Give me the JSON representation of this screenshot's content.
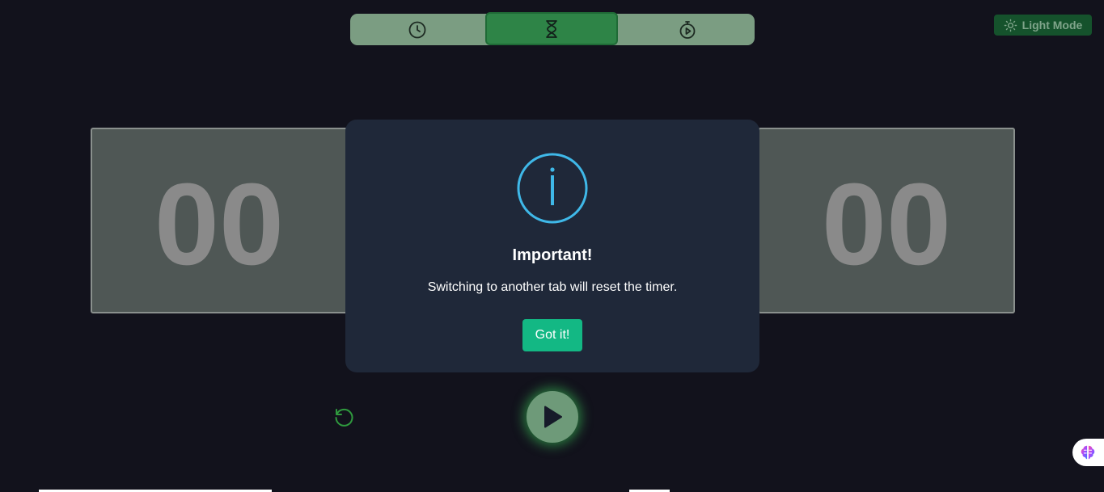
{
  "nav": {
    "tabs": [
      {
        "icon": "clock-icon",
        "active": false
      },
      {
        "icon": "hourglass-icon",
        "active": true
      },
      {
        "icon": "stopwatch-icon",
        "active": false
      }
    ]
  },
  "theme_toggle": {
    "label": "Light Mode",
    "icon": "sun-icon"
  },
  "timer": {
    "left_digits": "00",
    "right_digits": "00"
  },
  "modal": {
    "icon": "info-icon",
    "title": "Important!",
    "message": "Switching to another tab will reset the timer.",
    "button_label": "Got it!"
  },
  "controls": {
    "reset_icon": "reset-icon",
    "play_icon": "play-icon"
  },
  "colors": {
    "background": "#12121c",
    "accent_green": "#2e8447",
    "modal_bg": "#1f2839",
    "info_blue": "#3fb8e8",
    "button_green": "#13b884"
  }
}
